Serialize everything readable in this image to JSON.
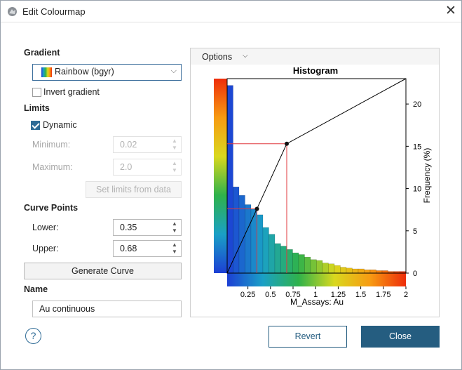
{
  "window": {
    "title": "Edit Colourmap",
    "close_glyph": "✕",
    "icon": "app-logo-icon"
  },
  "gradient": {
    "section_label": "Gradient",
    "selected": "Rainbow (bgyr)",
    "invert_label": "Invert gradient",
    "invert_checked": false
  },
  "limits": {
    "section_label": "Limits",
    "dynamic_label": "Dynamic",
    "dynamic_checked": true,
    "minimum_label": "Minimum:",
    "minimum_value": "0.02",
    "maximum_label": "Maximum:",
    "maximum_value": "2.0",
    "set_limits_label": "Set limits from data"
  },
  "curve_points": {
    "section_label": "Curve Points",
    "lower_label": "Lower:",
    "lower_value": "0.35",
    "upper_label": "Upper:",
    "upper_value": "0.68",
    "generate_label": "Generate Curve"
  },
  "name": {
    "section_label": "Name",
    "value": "Au continuous"
  },
  "panel": {
    "options_label": "Options"
  },
  "footer": {
    "help_glyph": "?",
    "revert_label": "Revert",
    "close_label": "Close"
  },
  "chart_data": {
    "type": "bar",
    "title": "Histogram",
    "xlabel": "M_Assays: Au",
    "ylabel": "Frequency (%)",
    "x_ticks": [
      "0.25",
      "0.5",
      "0.75",
      "1",
      "1.25",
      "1.5",
      "1.75",
      "2"
    ],
    "x_tick_values": [
      0.25,
      0.5,
      0.75,
      1,
      1.25,
      1.5,
      1.75,
      2
    ],
    "y_ticks": [
      "0",
      "5",
      "10",
      "15",
      "20"
    ],
    "y_tick_values": [
      0,
      5,
      10,
      15,
      20
    ],
    "xlim": [
      0.02,
      2.0
    ],
    "ylim": [
      0,
      23
    ],
    "bin_width": 0.066,
    "values": [
      22.2,
      10.2,
      9.2,
      8.1,
      7.6,
      6.9,
      5.4,
      4.6,
      3.5,
      3.2,
      2.8,
      2.4,
      2.2,
      1.9,
      1.6,
      1.5,
      1.2,
      1.1,
      0.9,
      0.7,
      0.6,
      0.5,
      0.5,
      0.4,
      0.4,
      0.3,
      0.3,
      0.2,
      0.2,
      0.2
    ],
    "curve_points": [
      {
        "x": 0.02,
        "y": 0
      },
      {
        "x": 0.35,
        "y": 7.6
      },
      {
        "x": 0.68,
        "y": 15.3
      },
      {
        "x": 2.0,
        "y": 23
      }
    ],
    "grid": false,
    "colormap": [
      "#1c3fd4",
      "#1aa0c6",
      "#2fb24b",
      "#d9d81e",
      "#f79b12",
      "#ee2d0a"
    ]
  }
}
